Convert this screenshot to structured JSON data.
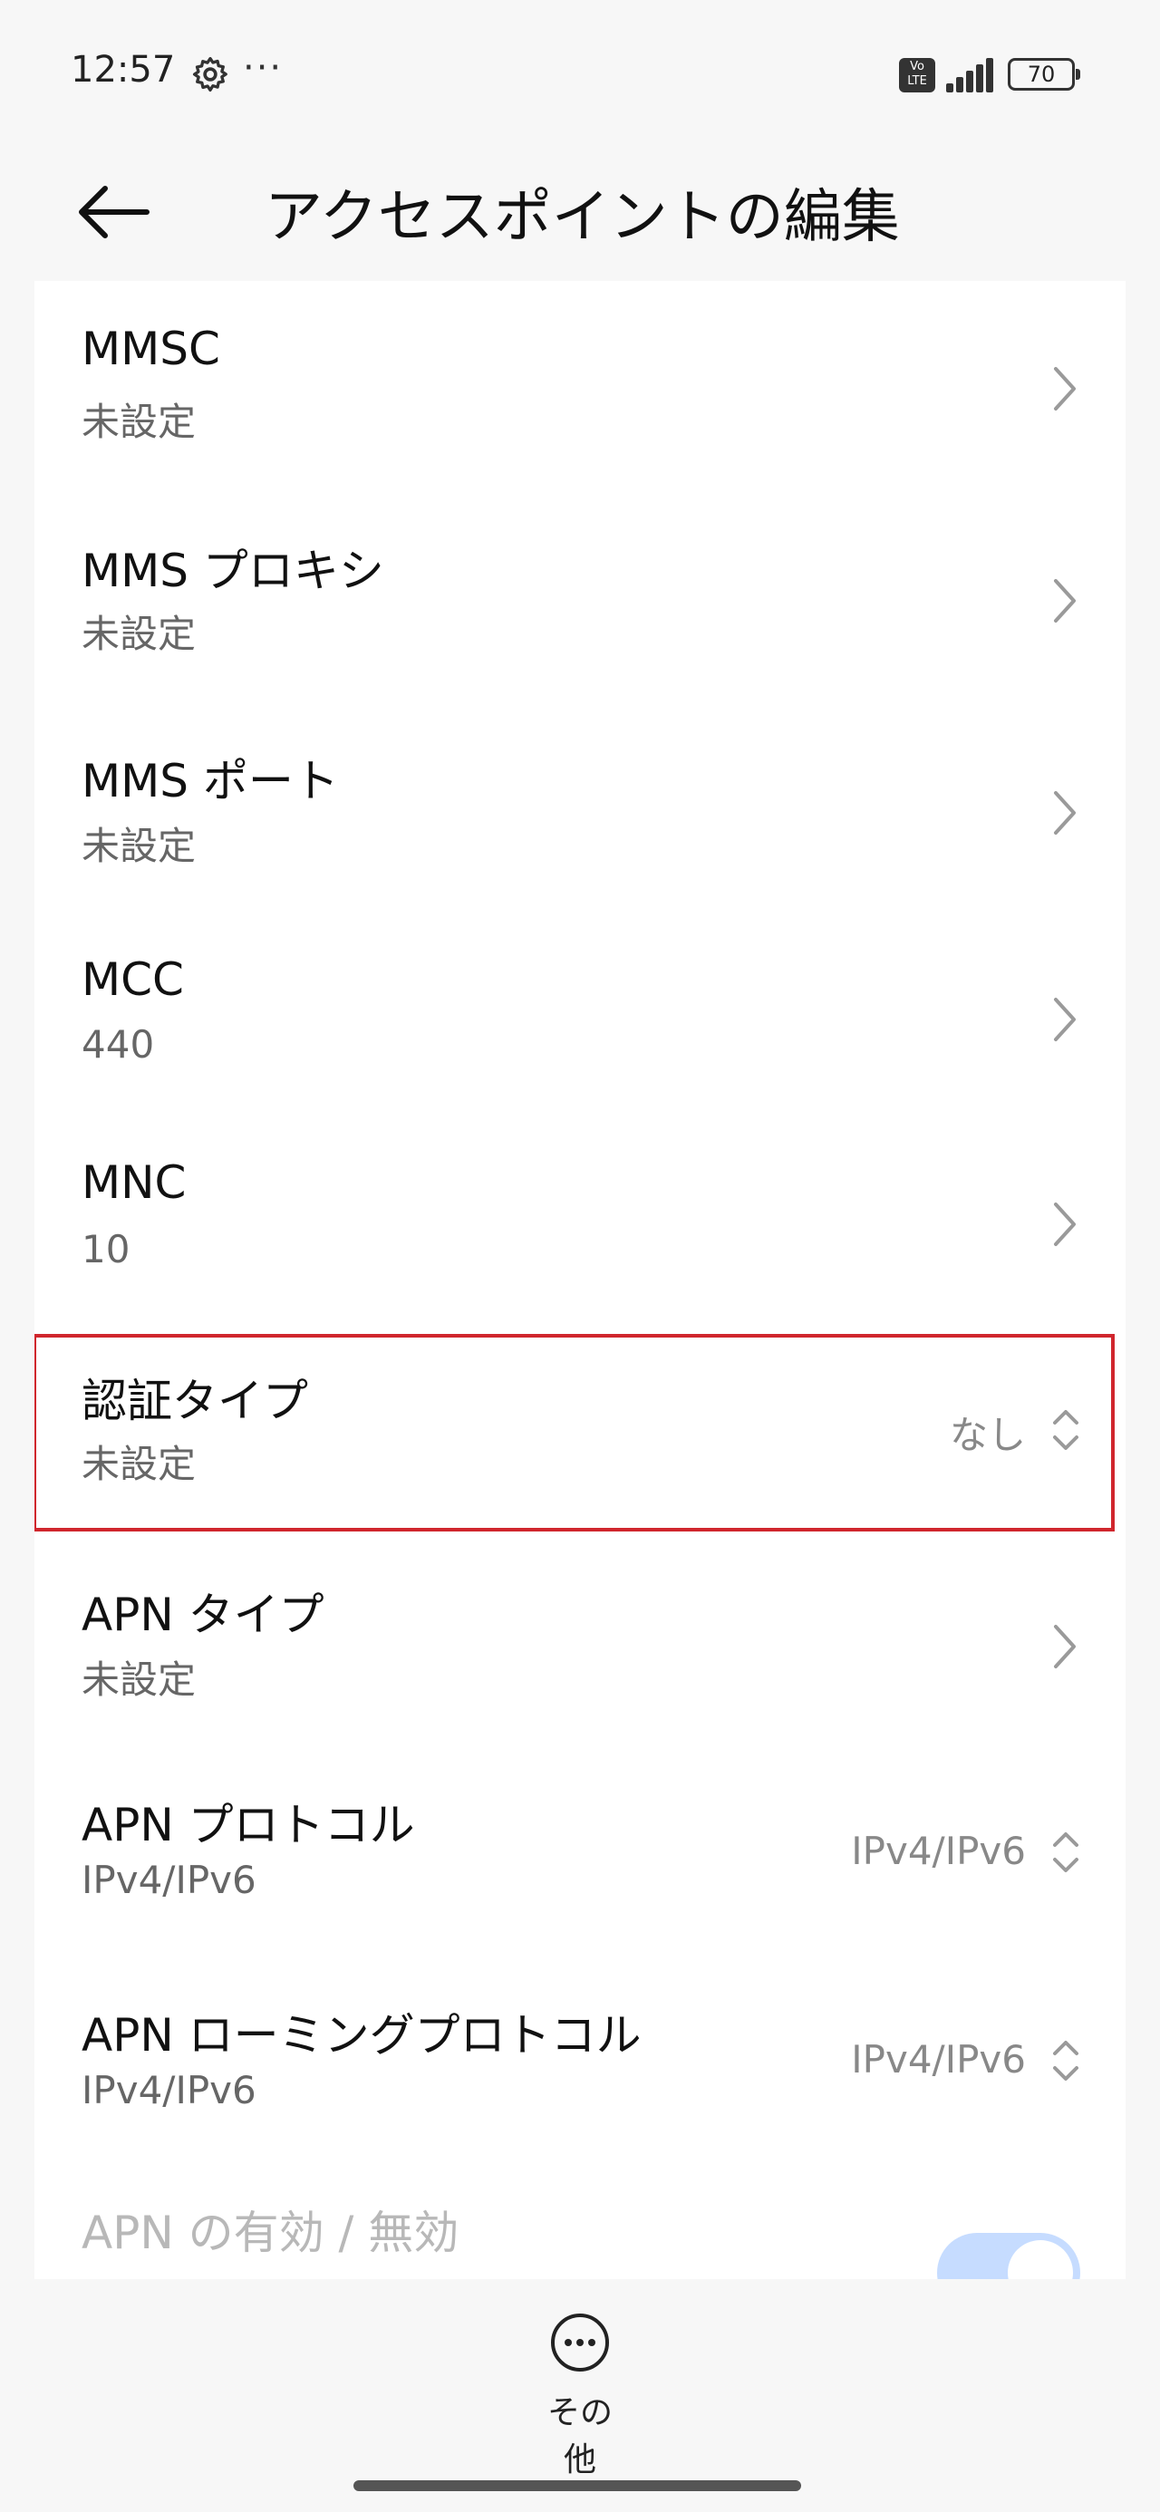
{
  "status_bar": {
    "time": "12:57",
    "more": "···",
    "volte_label": "Vo\nLTE",
    "battery": "70",
    "icons": [
      "gear-icon",
      "volte-icon",
      "signal-icon",
      "battery-icon"
    ]
  },
  "header": {
    "title": "アクセスポイントの編集",
    "back_icon": "arrow-left-icon"
  },
  "list": {
    "items": [
      {
        "title": "MMSC",
        "value": "未設定",
        "control": "chevron-right"
      },
      {
        "title": "MMS プロキシ",
        "value": "未設定",
        "control": "chevron-right"
      },
      {
        "title": "MMS ポート",
        "value": "未設定",
        "control": "chevron-right"
      },
      {
        "title": "MCC",
        "value": "440",
        "control": "chevron-right"
      },
      {
        "title": "MNC",
        "value": "10",
        "control": "chevron-right"
      },
      {
        "title": "認証タイプ",
        "value": "未設定",
        "selected": "なし",
        "control": "dropdown",
        "highlighted": true
      },
      {
        "title": "APN タイプ",
        "value": "未設定",
        "control": "chevron-right"
      },
      {
        "title": "APN プロトコル",
        "value": "IPv4/IPv6",
        "selected": "IPv4/IPv6",
        "control": "dropdown"
      },
      {
        "title": "APN ローミングプロトコル",
        "value": "IPv4/IPv6",
        "selected": "IPv4/IPv6",
        "control": "dropdown"
      },
      {
        "title": "APN の有効 / 無効",
        "control": "toggle",
        "toggle_on": true,
        "disabled": true
      }
    ]
  },
  "bottom_bar": {
    "more_label": "その他",
    "more_icon": "ellipsis-circle-icon"
  },
  "colors": {
    "highlight_border": "#d0262d",
    "toggle_on": "#c6dcff",
    "background": "#f7f7f7"
  }
}
